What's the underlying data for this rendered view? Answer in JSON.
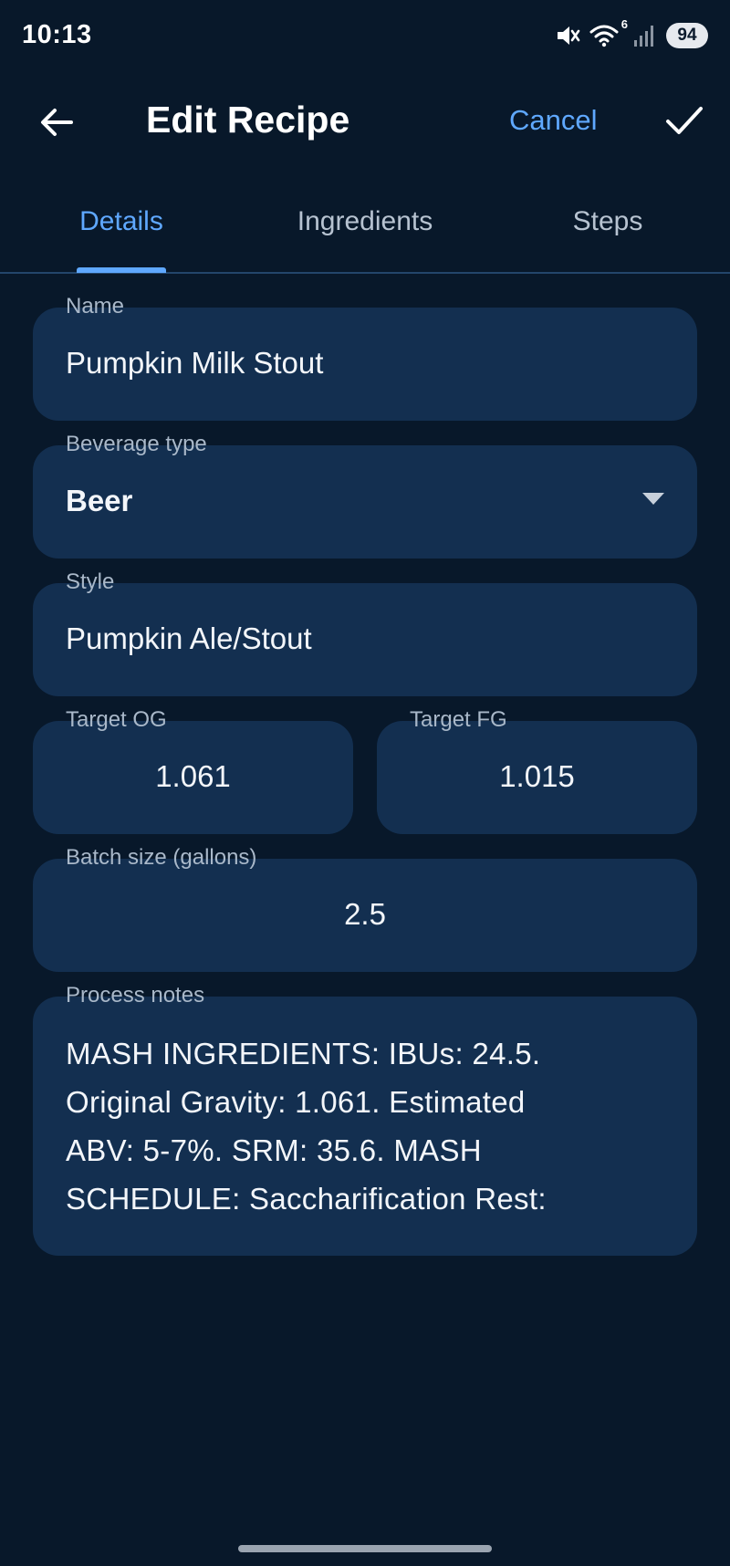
{
  "status_bar": {
    "time": "10:13",
    "wifi_badge": "6",
    "battery": "94",
    "icons": [
      "mute-icon",
      "wifi-icon",
      "signal-icon",
      "battery-icon"
    ]
  },
  "app_bar": {
    "title": "Edit Recipe",
    "cancel_label": "Cancel",
    "back_icon": "arrow-left-icon",
    "confirm_icon": "check-icon"
  },
  "tabs": [
    {
      "label": "Details",
      "active": true
    },
    {
      "label": "Ingredients",
      "active": false
    },
    {
      "label": "Steps",
      "active": false
    }
  ],
  "form": {
    "name": {
      "label": "Name",
      "value": "Pumpkin Milk Stout"
    },
    "beverage_type": {
      "label": "Beverage type",
      "value": "Beer"
    },
    "style": {
      "label": "Style",
      "value": "Pumpkin Ale/Stout"
    },
    "target_og": {
      "label": "Target OG",
      "value": "1.061"
    },
    "target_fg": {
      "label": "Target FG",
      "value": "1.015"
    },
    "batch_size": {
      "label": "Batch size (gallons)",
      "value": "2.5"
    },
    "process_notes": {
      "label": "Process notes",
      "lines": [
        "MASH INGREDIENTS: IBUs: 24.5.",
        "Original Gravity: 1.061. Estimated",
        "ABV: 5-7%. SRM: 35.6. MASH",
        "SCHEDULE: Saccharification Rest:"
      ]
    }
  },
  "colors": {
    "background": "#08182a",
    "field": "#132f50",
    "accent": "#5fa8ff",
    "label": "#a9b8c9"
  }
}
